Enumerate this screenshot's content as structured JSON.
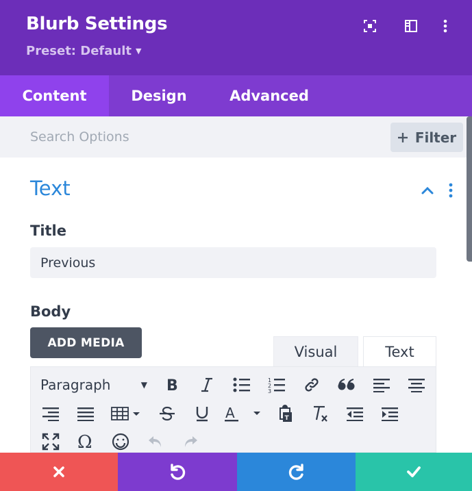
{
  "header": {
    "title": "Blurb Settings",
    "preset_label": "Preset: Default",
    "icons": [
      "fullscreen-icon",
      "sidebar-layout-icon",
      "more-vertical-icon"
    ]
  },
  "tabs": [
    {
      "label": "Content",
      "active": true
    },
    {
      "label": "Design",
      "active": false
    },
    {
      "label": "Advanced",
      "active": false
    }
  ],
  "search": {
    "placeholder": "Search Options",
    "value": "",
    "filter_label": "Filter"
  },
  "section": {
    "title": "Text"
  },
  "fields": {
    "title_label": "Title",
    "title_value": "Previous",
    "body_label": "Body",
    "add_media_label": "ADD MEDIA"
  },
  "editor": {
    "tabs": [
      {
        "label": "Visual",
        "active": true
      },
      {
        "label": "Text",
        "active": false
      }
    ],
    "format_select": "Paragraph",
    "toolbar_icons": [
      "bold-icon",
      "italic-icon",
      "bullet-list-icon",
      "numbered-list-icon",
      "link-icon",
      "blockquote-icon",
      "align-left-icon",
      "align-center-icon",
      "align-right-icon",
      "align-justify-icon",
      "table-icon",
      "strikethrough-icon",
      "underline-icon",
      "text-color-icon",
      "paste-text-icon",
      "clear-formatting-icon",
      "outdent-icon",
      "indent-icon",
      "fullscreen-icon",
      "special-character-icon",
      "emoji-icon",
      "undo-icon",
      "redo-icon"
    ]
  },
  "footer": {
    "buttons": [
      {
        "name": "cancel",
        "icon": "close-icon",
        "color": "#ef5555"
      },
      {
        "name": "undo",
        "icon": "undo-icon",
        "color": "#7d3bcf"
      },
      {
        "name": "redo",
        "icon": "redo-icon",
        "color": "#2b87da"
      },
      {
        "name": "save",
        "icon": "check-icon",
        "color": "#29c4a9"
      }
    ]
  },
  "colors": {
    "header_bg": "#6c2eb9",
    "tabs_bg": "#7e3bd0",
    "active_tab_bg": "#8f42ec",
    "section_title": "#2b87da"
  }
}
